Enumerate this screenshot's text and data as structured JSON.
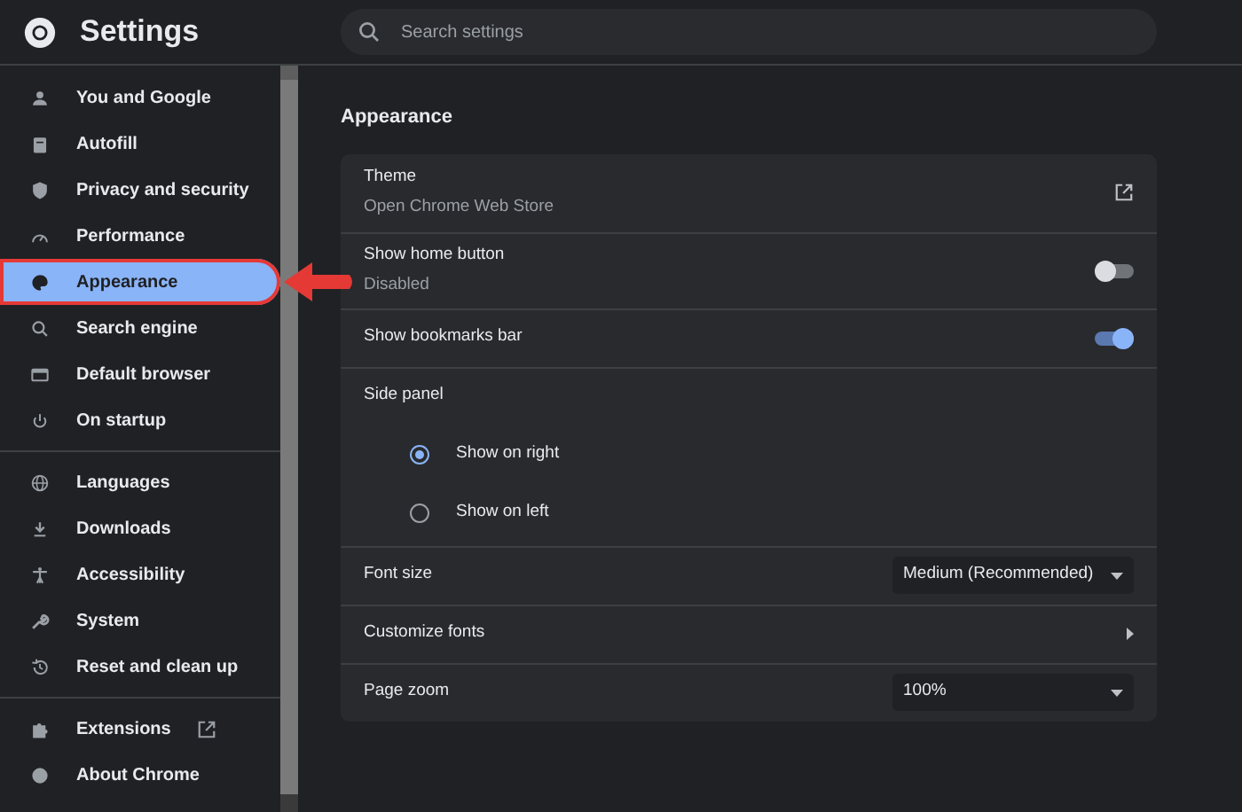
{
  "header": {
    "title": "Settings",
    "search": {
      "placeholder": "Search settings"
    }
  },
  "sidebar": {
    "groups": [
      {
        "items": [
          {
            "label": "You and Google",
            "selected": false,
            "highlighted": false
          },
          {
            "label": "Autofill",
            "selected": false,
            "highlighted": false
          },
          {
            "label": "Privacy and security",
            "selected": false,
            "highlighted": false
          },
          {
            "label": "Performance",
            "selected": false,
            "highlighted": false
          },
          {
            "label": "Appearance",
            "selected": true,
            "highlighted": true
          },
          {
            "label": "Search engine",
            "selected": false,
            "highlighted": false
          },
          {
            "label": "Default browser",
            "selected": false,
            "highlighted": false
          },
          {
            "label": "On startup",
            "selected": false,
            "highlighted": false
          }
        ]
      },
      {
        "items": [
          {
            "label": "Languages",
            "selected": false,
            "highlighted": false
          },
          {
            "label": "Downloads",
            "selected": false,
            "highlighted": false
          },
          {
            "label": "Accessibility",
            "selected": false,
            "highlighted": false
          },
          {
            "label": "System",
            "selected": false,
            "highlighted": false
          },
          {
            "label": "Reset and clean up",
            "selected": false,
            "highlighted": false
          }
        ]
      },
      {
        "items": [
          {
            "label": "Extensions",
            "selected": false,
            "highlighted": false,
            "external": true
          },
          {
            "label": "About Chrome",
            "selected": false,
            "highlighted": false,
            "external": false
          }
        ]
      }
    ]
  },
  "section": {
    "title": "Appearance",
    "rows": [
      {
        "kind": "link",
        "label": "Theme",
        "sublabel": "Open Chrome Web Store"
      },
      {
        "kind": "toggle",
        "label": "Show home button",
        "sublabel": "Disabled",
        "on": false
      },
      {
        "kind": "toggle",
        "label": "Show bookmarks bar",
        "on": true
      },
      {
        "kind": "radio",
        "label": "Side panel",
        "options": [
          {
            "label": "Show on right",
            "selected": true
          },
          {
            "label": "Show on left",
            "selected": false
          }
        ]
      },
      {
        "kind": "select",
        "label": "Font size",
        "value": "Medium (Recommended)"
      },
      {
        "kind": "submenu",
        "label": "Customize fonts"
      },
      {
        "kind": "select",
        "label": "Page zoom",
        "value": "100%"
      }
    ]
  }
}
